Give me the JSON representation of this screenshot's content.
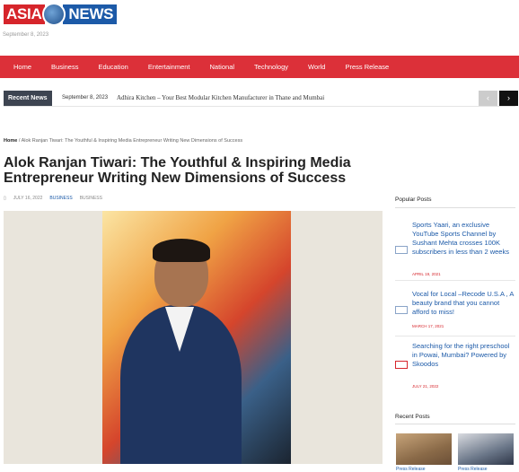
{
  "logo": {
    "part1": "ASIA",
    "part2": "NEWS"
  },
  "top_date": "September 8, 2023",
  "nav": [
    "Home",
    "Business",
    "Education",
    "Entertainment",
    "National",
    "Technology",
    "World",
    "Press Release"
  ],
  "ticker": {
    "label": "Recent News",
    "date": "September 8, 2023",
    "headline": "Adhira Kitchen – Your Best Modular Kitchen Manufacturer in Thane and Mumbai",
    "prev": "‹",
    "next": "›"
  },
  "breadcrumb": {
    "home": "Home",
    "sep": "/",
    "current": "Alok Ranjan Tiwari: The Youthful & Inspiring Media Entrepreneur Writing New Dimensions of Success"
  },
  "article": {
    "title": "Alok Ranjan Tiwari: The Youthful & Inspiring Media Entrepreneur Writing New Dimensions of Success",
    "date": "JULY 16, 2022",
    "categories": [
      "BUSINESS",
      "BUSINESS"
    ]
  },
  "sidebar": {
    "popular_title": "Popular Posts",
    "popular": [
      {
        "title": "Sports Yaari, an exclusive YouTube Sports Channel by Sushant Mehta crosses 100K subscribers in less than 2 weeks",
        "date": "APRIL 19, 2021"
      },
      {
        "title": "Vocal for Local –Recode U.S.A , A beauty brand that you cannot afford to miss!",
        "date": "MARCH 17, 2021"
      },
      {
        "title": "Searching for the right preschool in Powai, Mumbai? Powered by Skoodos",
        "date": "JULY 21, 2022"
      }
    ],
    "recent_title": "Recent Posts",
    "recent": [
      {
        "label": "Press Release"
      },
      {
        "label": "Press Release"
      }
    ]
  }
}
